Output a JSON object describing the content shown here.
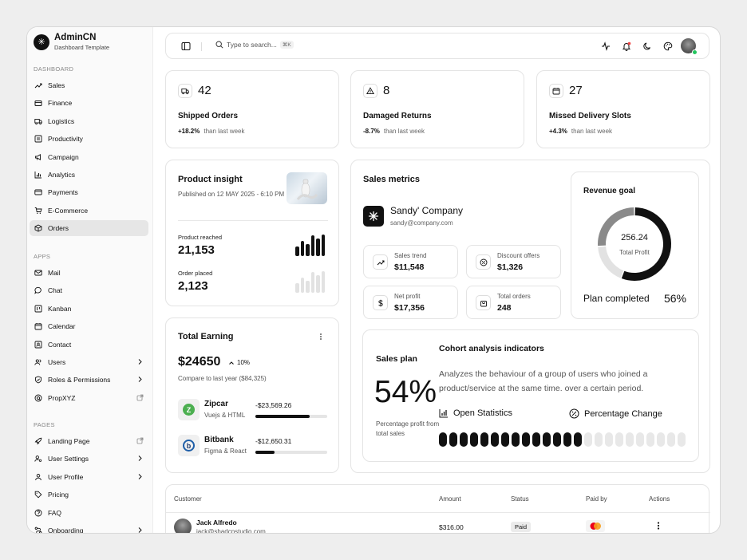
{
  "brand": {
    "name": "AdminCN",
    "subtitle": "Dashboard Template"
  },
  "sidebar": {
    "sections": [
      {
        "title": "DASHBOARD",
        "items": [
          {
            "label": "Sales",
            "icon": "trend-icon"
          },
          {
            "label": "Finance",
            "icon": "wallet-icon"
          },
          {
            "label": "Logistics",
            "icon": "truck-icon"
          },
          {
            "label": "Productivity",
            "icon": "list-icon"
          },
          {
            "label": "Campaign",
            "icon": "megaphone-icon"
          },
          {
            "label": "Analytics",
            "icon": "chart-icon"
          },
          {
            "label": "Payments",
            "icon": "card-icon"
          },
          {
            "label": "E-Commerce",
            "icon": "cart-icon"
          },
          {
            "label": "Orders",
            "icon": "box-icon",
            "active": true
          }
        ]
      },
      {
        "title": "APPS",
        "items": [
          {
            "label": "Mail",
            "icon": "mail-icon"
          },
          {
            "label": "Chat",
            "icon": "chat-icon"
          },
          {
            "label": "Kanban",
            "icon": "kanban-icon"
          },
          {
            "label": "Calendar",
            "icon": "calendar-icon"
          },
          {
            "label": "Contact",
            "icon": "contact-icon"
          },
          {
            "label": "Users",
            "icon": "users-icon",
            "chevron": true
          },
          {
            "label": "Roles & Permissions",
            "icon": "shield-icon",
            "chevron": true
          },
          {
            "label": "PropXYZ",
            "icon": "globe-icon",
            "external": true
          }
        ]
      },
      {
        "title": "PAGES",
        "items": [
          {
            "label": "Landing Page",
            "icon": "rocket-icon",
            "external": true
          },
          {
            "label": "User Settings",
            "icon": "user-cog-icon",
            "chevron": true
          },
          {
            "label": "User Profile",
            "icon": "user-icon",
            "chevron": true
          },
          {
            "label": "Pricing",
            "icon": "tag-icon"
          },
          {
            "label": "FAQ",
            "icon": "help-icon"
          },
          {
            "label": "Onboarding",
            "icon": "flow-icon",
            "chevron": true
          }
        ]
      }
    ]
  },
  "topbar": {
    "search_placeholder": "Type to search...",
    "search_shortcut": "⌘K"
  },
  "stats": [
    {
      "value": "42",
      "label": "Shipped Orders",
      "change": "+18.2%",
      "suffix": "than last week",
      "icon": "truck-icon"
    },
    {
      "value": "8",
      "label": "Damaged Returns",
      "change": "-8.7%",
      "suffix": "than last week",
      "icon": "warning-icon"
    },
    {
      "value": "27",
      "label": "Missed Delivery Slots",
      "change": "+4.3%",
      "suffix": "than last week",
      "icon": "calendar-icon"
    }
  ],
  "insight": {
    "title": "Product insight",
    "published": "Published on 12 MAY 2025 - 6:10 PM",
    "reached_label": "Product reached",
    "reached_value": "21,153",
    "placed_label": "Order placed",
    "placed_value": "2,123",
    "reached_bars": [
      0.45,
      0.7,
      0.55,
      0.95,
      0.8,
      1.0
    ],
    "placed_bars": [
      0.45,
      0.7,
      0.55,
      0.95,
      0.8,
      1.0
    ]
  },
  "earning": {
    "title": "Total Earning",
    "value": "$24650",
    "change": "10%",
    "compare": "Compare to last year ($84,325)",
    "items": [
      {
        "name": "Zipcar",
        "sub": "Vuejs & HTML",
        "amount": "-$23,569.26",
        "progress": 0.75,
        "logo": "Z"
      },
      {
        "name": "Bitbank",
        "sub": "Figma & React",
        "amount": "-$12,650.31",
        "progress": 0.27,
        "logo": "b"
      }
    ]
  },
  "sales_metrics": {
    "title": "Sales metrics",
    "company": "Sandy' Company",
    "email": "sandy@company.com",
    "metrics": [
      {
        "label": "Sales trend",
        "value": "$11,548",
        "icon": "trend-icon"
      },
      {
        "label": "Discount offers",
        "value": "$1,326",
        "icon": "percent-icon"
      },
      {
        "label": "Net profit",
        "value": "$17,356",
        "icon": "dollar-icon"
      },
      {
        "label": "Total orders",
        "value": "248",
        "icon": "bag-icon"
      }
    ]
  },
  "revenue": {
    "title": "Revenue goal",
    "value": "256.24",
    "sublabel": "Total Profit",
    "plan_label": "Plan completed",
    "plan_value": "56%",
    "segments": [
      0.56,
      0.18,
      0.26
    ]
  },
  "sales_plan": {
    "title": "Sales plan",
    "value": "54%",
    "caption": "Percentage profit from total sales",
    "cohort_title": "Cohort analysis indicators",
    "cohort_text": "Analyzes the behaviour of a group of users who joined a product/service at the same time. over a certain period.",
    "open_stats": "Open Statistics",
    "pct_change": "Percentage Change",
    "filled": 14,
    "total": 24
  },
  "table": {
    "headers": [
      "Customer",
      "Amount",
      "Status",
      "Paid by",
      "Actions"
    ],
    "rows": [
      {
        "name": "Jack Alfredo",
        "email": "jack@shadcnstudio.com",
        "amount": "$316.00",
        "status": "Paid",
        "paid_by": "mastercard"
      }
    ]
  },
  "colors": {
    "accent": "#111111",
    "muted_gray": "#8a8a8a",
    "light_gray": "#e6e6e6",
    "online": "#22c55e",
    "notify": "#ef4444"
  }
}
